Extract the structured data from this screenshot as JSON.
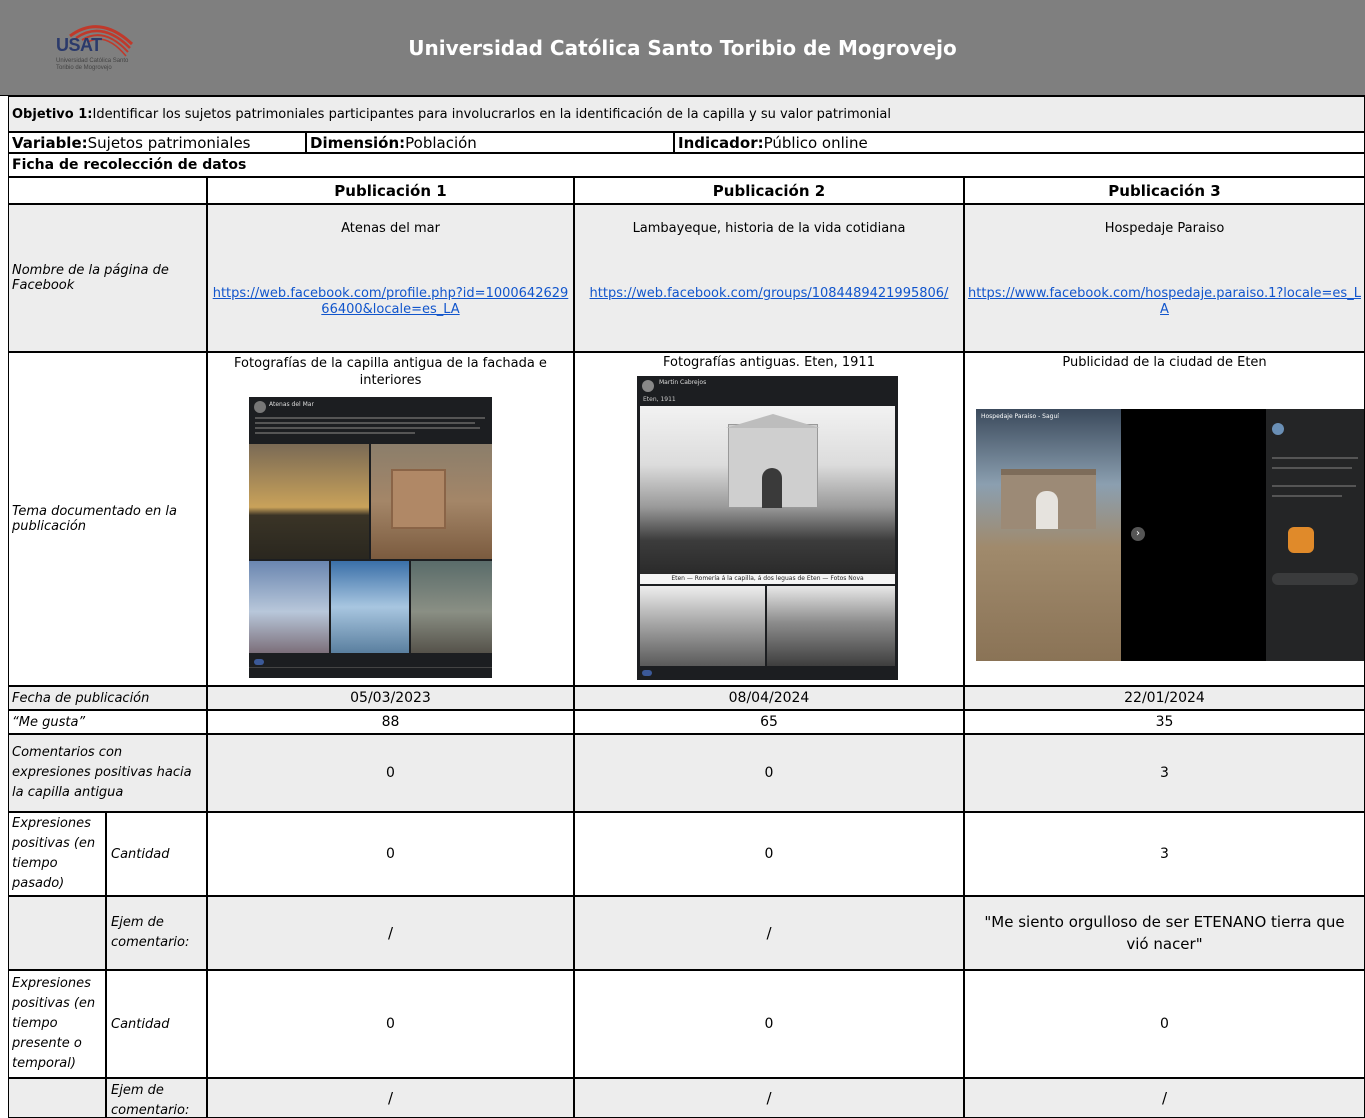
{
  "header": {
    "logo_text": "USAT",
    "logo_subtext": "Universidad Católica Santo Toribio de Mogrovejo",
    "title": "Universidad Católica Santo Toribio de Mogrovejo"
  },
  "objective": {
    "label": "Objetivo 1:",
    "text": " Identificar los sujetos patrimoniales participantes para involucrarlos en la identificación de la capilla y su valor patrimonial"
  },
  "meta": {
    "variable_label": "Variable:",
    "variable_value": " Sujetos patrimoniales",
    "dimension_label": "Dimensión:",
    "dimension_value": " Población",
    "indicator_label": "Indicador:",
    "indicator_value": " Público online"
  },
  "form_title": "Ficha de recolección de datos",
  "columns": [
    "Publicación 1",
    "Publicación 2",
    "Publicación 3"
  ],
  "rows": {
    "page_name": "Nombre de la página de Facebook",
    "topic": "Tema documentado en la publicación",
    "date": "Fecha de publicación",
    "likes": "“Me gusta”",
    "positive_comments": "Comentarios con expresiones positivas hacia la capilla antigua",
    "past_expr": "Expresiones positivas (en tiempo pasado)",
    "present_expr": "Expresiones positivas (en tiempo presente o temporal)",
    "quantity": "Cantidad",
    "example": "Ejem de comentario:"
  },
  "publications": [
    {
      "page_name": "Atenas del mar",
      "url": "https://web.facebook.com/profile.php?id=100064262966400&locale=es_LA",
      "topic": "Fotografías de la capilla antigua de la fachada e interiores",
      "date": "05/03/2023",
      "likes": "88",
      "positive_comments": "0",
      "past_quantity": "0",
      "past_example": "/",
      "present_quantity": "0",
      "present_example": "/"
    },
    {
      "page_name": "Lambayeque, historia de la vida cotidiana",
      "url": "https://web.facebook.com/groups/1084489421995806/",
      "topic": "Fotografías antiguas. Eten, 1911",
      "date": "08/04/2024",
      "likes": "65",
      "positive_comments": "0",
      "past_quantity": "0",
      "past_example": "/",
      "present_quantity": "0",
      "present_example": "/"
    },
    {
      "page_name": "Hospedaje Paraiso",
      "url": "https://www.facebook.com/hospedaje.paraiso.1?locale=es_LA",
      "topic": "Publicidad de la ciudad de Eten",
      "date": "22/01/2024",
      "likes": "35",
      "positive_comments": "3",
      "past_quantity": "3",
      "past_example": "\"Me siento orgulloso de ser ETENANO tierra que vió nacer\"",
      "present_quantity": "0",
      "present_example": "/"
    }
  ],
  "photos": {
    "p1_post_author": "Atenas del Mar",
    "p2_post_author": "Martin Cabrejos",
    "p2_post_date": "Eten, 1911",
    "p2_caption": "Eten — Romería á la capilla, á dos leguas de Eten — Fotos Nova",
    "p3_page": "Hospedaje Paraiso - Saguí"
  },
  "colors": {
    "header_bg": "#7f7f7f",
    "row_shade": "#ededed",
    "link": "#1155cc"
  }
}
